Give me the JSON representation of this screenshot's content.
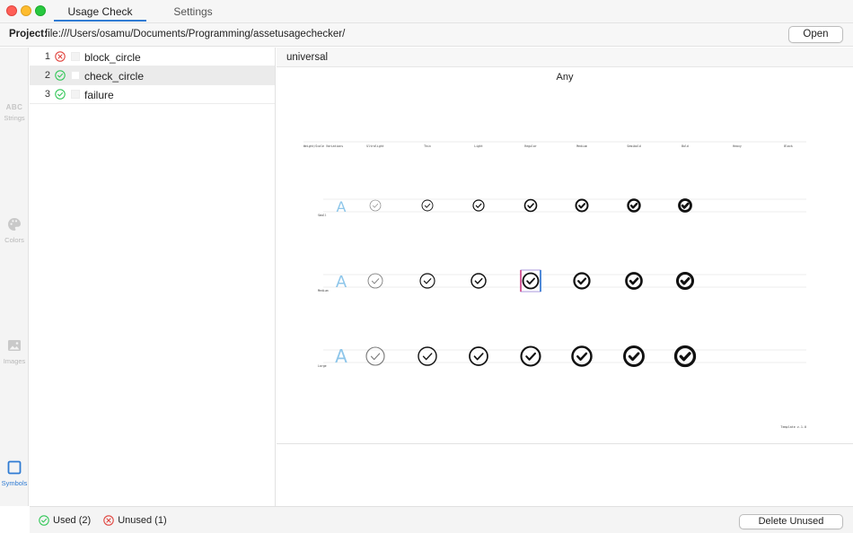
{
  "window": {
    "tabs": [
      {
        "label": "Usage Check",
        "active": true
      },
      {
        "label": "Settings",
        "active": false
      }
    ]
  },
  "project": {
    "label": "Project:",
    "path": "file:///Users/osamu/Documents/Programming/assetusagechecker/",
    "open_button": "Open"
  },
  "rail": {
    "items": [
      {
        "label": "Strings",
        "icon": "abc-icon",
        "glyph": "ABC",
        "active": false
      },
      {
        "label": "Colors",
        "icon": "palette-icon",
        "active": false
      },
      {
        "label": "Images",
        "icon": "image-icon",
        "active": false
      },
      {
        "label": "Symbols",
        "icon": "symbol-square-icon",
        "active": true
      }
    ]
  },
  "assets": [
    {
      "index": "1",
      "name": "block_circle",
      "status": "unused"
    },
    {
      "index": "2",
      "name": "check_circle",
      "status": "used"
    },
    {
      "index": "3",
      "name": "failure",
      "status": "used"
    }
  ],
  "detail": {
    "title": "universal",
    "appearance": "Any",
    "template": {
      "header_first": "Weight/Scale Variations",
      "weights": [
        "Ultralight",
        "Thin",
        "Light",
        "Regular",
        "Medium",
        "Semibold",
        "Bold",
        "Heavy",
        "Black"
      ],
      "scales": [
        "Small",
        "Medium",
        "Large"
      ],
      "reference_glyph": "A",
      "version": "Template v.1.0"
    }
  },
  "footer": {
    "used_label": "Used (2)",
    "unused_label": "Unused (1)",
    "delete_button": "Delete Unused"
  },
  "colors": {
    "accent": "#2f7bd3",
    "used_green": "#34c759",
    "unused_red": "#e0443e",
    "guide_blue": "#8ec6ea"
  }
}
